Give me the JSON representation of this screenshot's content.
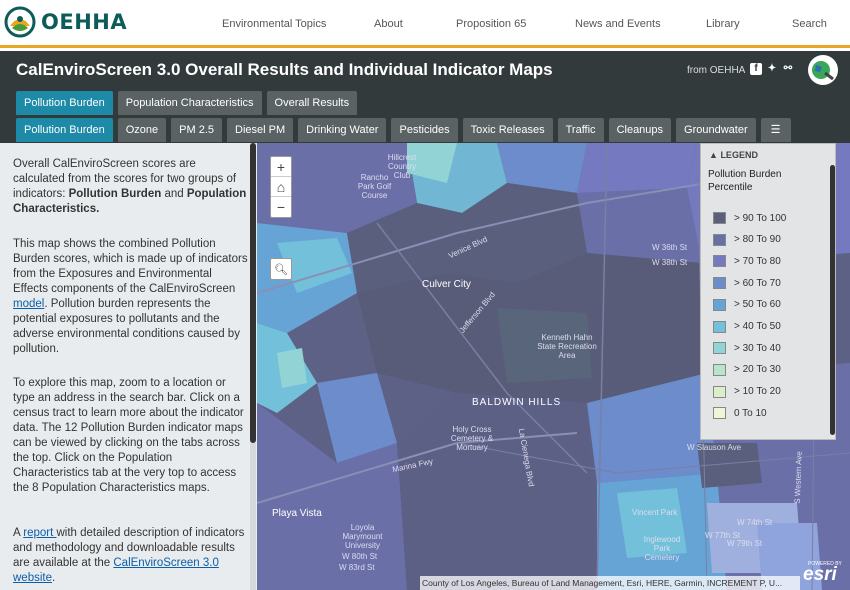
{
  "nav": {
    "logo_text": "OEHHA",
    "links": [
      "Environmental Topics",
      "About",
      "Proposition 65",
      "News and Events",
      "Library",
      "Search"
    ]
  },
  "header": {
    "title": "CalEnviroScreen 3.0 Overall Results and Individual Indicator Maps",
    "from": "from OEHHA"
  },
  "tabs_primary": [
    "Pollution Burden",
    "Population Characteristics",
    "Overall Results"
  ],
  "tabs_secondary": [
    "Pollution Burden",
    "Ozone",
    "PM 2.5",
    "Diesel PM",
    "Drinking Water",
    "Pesticides",
    "Toxic Releases",
    "Traffic",
    "Cleanups",
    "Groundwater"
  ],
  "panel": {
    "p1_a": "Overall CalEnviroScreen scores are calculated from the scores for two groups of indicators: ",
    "p1_b": "Pollution Burden",
    "p1_c": " and ",
    "p1_d": "Population Characteristics.",
    "p2_a": "This map shows the combined Pollution Burden scores, which is made up of indicators from the Exposures and Environmental Effects components of the CalEnviroScreen ",
    "p2_link": "model",
    "p2_b": ". Pollution burden represents the potential exposures to pollutants and the adverse environmental conditions caused by pollution.",
    "p3": "To explore this map, zoom to a location or type an address in the search bar.  Click on a census tract to learn more about the indicator data. The 12 Pollution Burden indicator maps can be viewed by clicking on the tabs across the top. Click on the Population Characteristics tab at the very top to access the 8 Population Characteristics maps.",
    "p4_a": "A ",
    "p4_link": "report ",
    "p4_b": "with detailed description of indicators and methodology and downloadable results are available at the ",
    "p4_link2": "CalEnviroScreen 3.0 website",
    "p4_c": "."
  },
  "map": {
    "labels": {
      "culver_city": "Culver City",
      "baldwin_hills": "BALDWIN HILLS",
      "playa_vista": "Playa Vista",
      "venice_blvd": "Venice Blvd",
      "jefferson_blvd": "Jefferson Blvd",
      "marina_fwy": "Marina Fwy",
      "la_cienega": "La Cienega Blvd",
      "kenneth_hahn": "Kenneth Hahn State Recreation Area",
      "hillcrest": "Hillcrest Country Club",
      "rancho_park": "Rancho Park Golf Course",
      "inglewood_park": "Inglewood Park Cemetery",
      "vincent_park": "Vincent Park",
      "lmu": "Loyola Marymount University",
      "holy_cross": "Holy Cross Cemetery & Mortuary",
      "w_slauson": "W Slauson Ave",
      "w_74th": "W 74th St",
      "w_77th": "W 77th St",
      "w_79th": "W 79th St",
      "w_80th": "W 80th St",
      "w_83rd": "W 83rd St",
      "s_western": "S Western Ave",
      "w_38th": "W 38th St",
      "w_36th": "W 36th St"
    },
    "attribution": "County of Los Angeles, Bureau of Land Management, Esri, HERE, Garmin, INCREMENT P, U...",
    "esri_powered": "POWERED BY",
    "esri": "esri"
  },
  "legend": {
    "header": "LEGEND",
    "title": "Pollution Burden Percentile",
    "items": [
      {
        "label": "> 90 To 100",
        "color": "#5a5f7d"
      },
      {
        "label": "> 80 To 90",
        "color": "#6a6fa8"
      },
      {
        "label": "> 70 To 80",
        "color": "#7479c0"
      },
      {
        "label": "> 60 To 70",
        "color": "#6c8ccb"
      },
      {
        "label": "> 50 To 60",
        "color": "#67a4d6"
      },
      {
        "label": "> 40 To 50",
        "color": "#73c0da"
      },
      {
        "label": "> 30 To 40",
        "color": "#92d3d6"
      },
      {
        "label": "> 20 To 30",
        "color": "#b9e2cf"
      },
      {
        "label": "> 10 To 20",
        "color": "#d9eec9"
      },
      {
        "label": "0 To 10",
        "color": "#eef6d9"
      }
    ]
  }
}
